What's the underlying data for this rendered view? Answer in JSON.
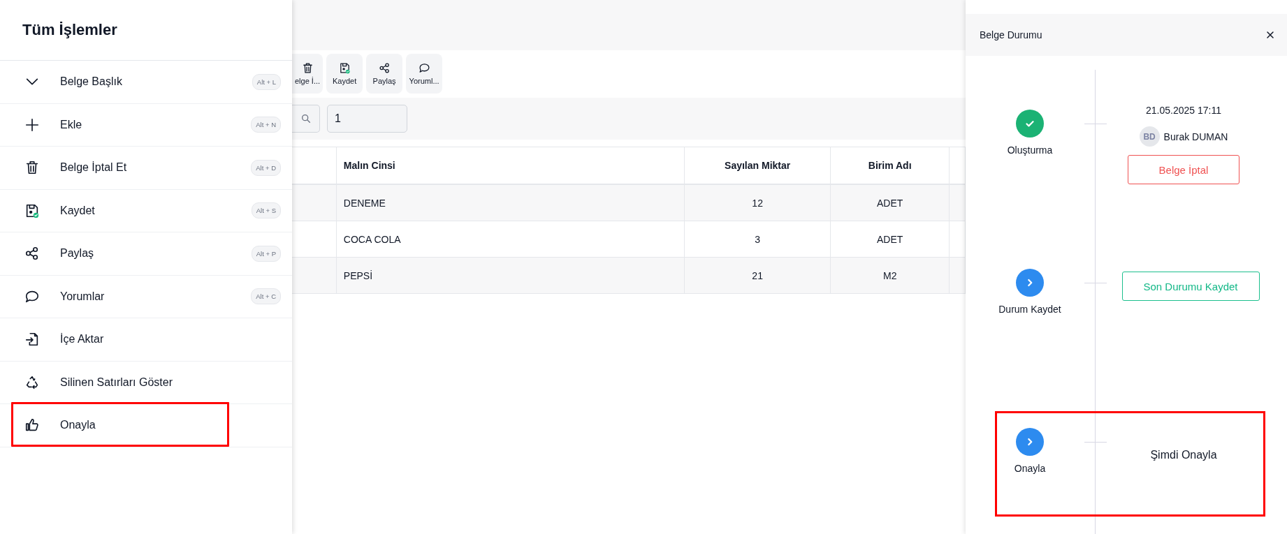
{
  "menu": {
    "title": "Tüm İşlemler",
    "items": [
      {
        "kind": "chevron",
        "label": "Belge Başlık",
        "shortcut": "Alt + L",
        "highlighted": false
      },
      {
        "kind": "plus",
        "label": "Ekle",
        "shortcut": "Alt + N",
        "highlighted": false
      },
      {
        "kind": "trash",
        "label": "Belge İptal Et",
        "shortcut": "Alt + D",
        "highlighted": false
      },
      {
        "kind": "save",
        "label": "Kaydet",
        "shortcut": "Alt + S",
        "highlighted": false
      },
      {
        "kind": "share",
        "label": "Paylaş",
        "shortcut": "Alt + P",
        "highlighted": false
      },
      {
        "kind": "comment",
        "label": "Yorumlar",
        "shortcut": "Alt + C",
        "highlighted": false
      },
      {
        "kind": "import",
        "label": "İçe Aktar",
        "highlighted": false
      },
      {
        "kind": "recycle",
        "label": "Silinen Satırları Göster",
        "highlighted": false
      },
      {
        "kind": "thumb",
        "label": "Onayla",
        "highlighted": true
      }
    ]
  },
  "toolbar": {
    "buttons": [
      {
        "kind": "trash",
        "label": "elge İ..."
      },
      {
        "kind": "save",
        "label": "Kaydet"
      },
      {
        "kind": "share",
        "label": "Paylaş"
      },
      {
        "kind": "comment",
        "label": "Yoruml..."
      }
    ]
  },
  "filter": {
    "value": "1"
  },
  "table": {
    "columns": [
      "Malın Cinsi",
      "Sayılan Miktar",
      "Birim Adı"
    ],
    "rows": [
      [
        "DENEME",
        "12",
        "ADET"
      ],
      [
        "COCA COLA",
        "3",
        "ADET"
      ],
      [
        "PEPSİ",
        "21",
        "M2"
      ]
    ]
  },
  "status_panel": {
    "title": "Belge Durumu",
    "steps": [
      {
        "label": "Oluşturma",
        "kind": "done",
        "date": "21.05.2025 17:11",
        "user": {
          "initials": "BD",
          "name": "Burak DUMAN"
        },
        "action": {
          "label": "Belge İptal",
          "kind": "danger"
        },
        "highlighted": false
      },
      {
        "label": "Durum Kaydet",
        "kind": "pending",
        "action": {
          "label": "Son Durumu Kaydet",
          "kind": "success"
        },
        "highlighted": false
      },
      {
        "label": "Onayla",
        "kind": "pending",
        "text": "Şimdi Onayla",
        "highlighted": true
      }
    ]
  }
}
